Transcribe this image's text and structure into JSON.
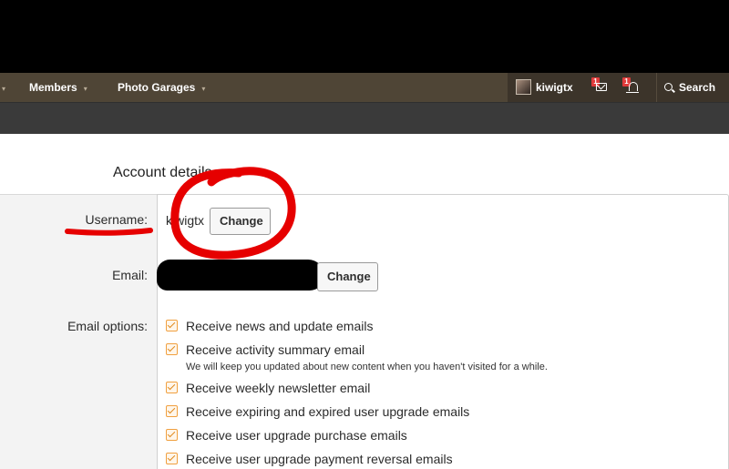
{
  "nav": {
    "caret_glyph": "▾",
    "items": [
      {
        "label": "Members"
      },
      {
        "label": "Photo Garages"
      }
    ],
    "user": {
      "name": "kiwigtx"
    },
    "inbox_badge": "1",
    "alerts_badge": "1",
    "search_label": "Search"
  },
  "account": {
    "section_title": "Account details",
    "username_label": "Username:",
    "username_value": "kiwigtx",
    "username_change": "Change",
    "email_label": "Email:",
    "email_change": "Change",
    "email_options_label": "Email options:",
    "options": [
      {
        "label": "Receive news and update emails",
        "checked": true
      },
      {
        "label": "Receive activity summary email",
        "checked": true,
        "hint": "We will keep you updated about new content when you haven't visited for a while."
      },
      {
        "label": "Receive weekly newsletter email",
        "checked": true
      },
      {
        "label": "Receive expiring and expired user upgrade emails",
        "checked": true
      },
      {
        "label": "Receive user upgrade purchase emails",
        "checked": true
      },
      {
        "label": "Receive user upgrade payment reversal emails",
        "checked": true
      }
    ]
  },
  "colors": {
    "navbar": "#4f4536",
    "annotation": "#e60000",
    "checkbox": "#f0a040"
  }
}
